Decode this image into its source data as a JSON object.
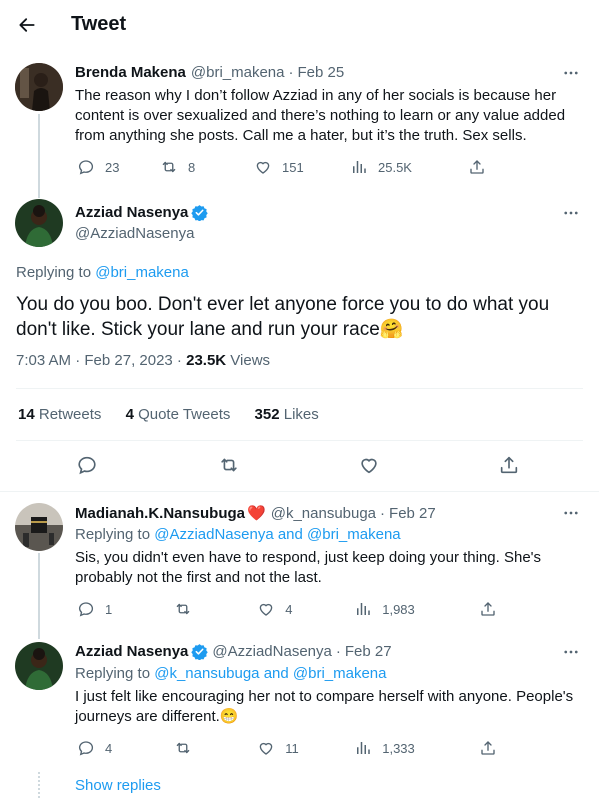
{
  "header": {
    "title": "Tweet"
  },
  "parent": {
    "name": "Brenda Makena",
    "handle": "@bri_makena",
    "date": "Feb 25",
    "text": "The reason why I don’t follow Azziad in any of her socials is because her content is over sexualized and there’s nothing to learn or any value added from anything she posts. Call me a hater, but it’s the truth. Sex sells.",
    "replies": "23",
    "retweets": "8",
    "likes": "151",
    "views": "25.5K"
  },
  "main": {
    "name": "Azziad Nasenya",
    "handle": "@AzziadNasenya",
    "replying_prefix": "Replying to ",
    "replying_to": "@bri_makena",
    "text": "You do you boo. Don't ever let anyone force you to do what you don't like. Stick your lane and run your race🤗",
    "time": "7:03 AM · Feb 27, 2023 · ",
    "views_count": "23.5K",
    "views_label": " Views",
    "retweets_count": "14",
    "retweets_label": "Retweets",
    "quotes_count": "4",
    "quotes_label": "Quote Tweets",
    "likes_count": "352",
    "likes_label": "Likes"
  },
  "replies": [
    {
      "name": "Madianah.K.Nansubuga",
      "heart": "❤️",
      "handle": "@k_nansubuga",
      "date": "Feb 27",
      "replying_prefix": "Replying to ",
      "replying_to": "@AzziadNasenya and @bri_makena",
      "text": "Sis, you didn't even have to respond, just keep doing your thing. She's probably not the first and not the last.",
      "replies": "1",
      "retweets": "",
      "likes": "4",
      "views": "1,983"
    },
    {
      "name": "Azziad Nasenya",
      "handle": "@AzziadNasenya",
      "date": "Feb 27",
      "replying_prefix": "Replying to ",
      "replying_to": "@k_nansubuga and @bri_makena",
      "text": "I just felt like encouraging her not to compare herself with anyone. People's journeys are different.😁",
      "replies": "4",
      "retweets": "",
      "likes": "11",
      "views": "1,333"
    }
  ],
  "show_replies": "Show replies",
  "colors": {
    "accent": "#1d9bf0",
    "secondary_text": "#536471",
    "verified": "#1d9bf0"
  },
  "icons": [
    "back-arrow-icon",
    "more-icon",
    "reply-icon",
    "retweet-icon",
    "like-icon",
    "views-icon",
    "share-icon",
    "verified-icon"
  ]
}
